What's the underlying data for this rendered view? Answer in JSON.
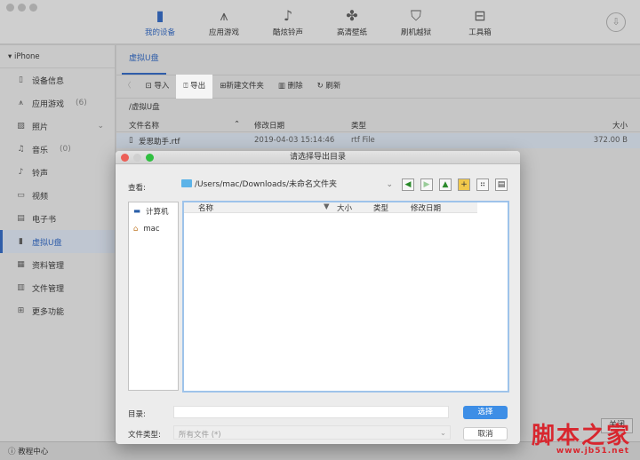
{
  "nav": [
    {
      "label": "我的设备",
      "icon": "phone-icon"
    },
    {
      "label": "应用游戏",
      "icon": "app-icon"
    },
    {
      "label": "酷炫铃声",
      "icon": "music-note-icon"
    },
    {
      "label": "高清壁纸",
      "icon": "clover-icon"
    },
    {
      "label": "刷机越狱",
      "icon": "shield-icon"
    },
    {
      "label": "工具箱",
      "icon": "toolbox-icon"
    }
  ],
  "sidebar": {
    "device": "iPhone",
    "items": [
      {
        "label": "设备信息"
      },
      {
        "label": "应用游戏",
        "count": "(6)"
      },
      {
        "label": "照片"
      },
      {
        "label": "音乐",
        "count": "(0)"
      },
      {
        "label": "铃声"
      },
      {
        "label": "视频"
      },
      {
        "label": "电子书"
      },
      {
        "label": "虚拟U盘"
      },
      {
        "label": "资料管理"
      },
      {
        "label": "文件管理"
      },
      {
        "label": "更多功能"
      }
    ],
    "help": "教程中心"
  },
  "main": {
    "tab": "虚拟U盘",
    "toolbar": {
      "import": "导入",
      "export": "导出",
      "new_folder": "新建文件夹",
      "delete": "删除",
      "refresh": "刷新"
    },
    "path": "/虚拟U盘",
    "columns": {
      "name": "文件名称",
      "date": "修改日期",
      "type": "类型",
      "size": "大小"
    },
    "rows": [
      {
        "name": "爱思助手.rtf",
        "date": "2019-04-03 15:14:46",
        "type": "rtf File",
        "size": "372.00 B"
      }
    ],
    "close_button": "关闭"
  },
  "dialog": {
    "title": "请选择导出目录",
    "look_in_label": "查看:",
    "look_in_value": "/Users/mac/Downloads/未命名文件夹",
    "places": [
      "计算机",
      "mac"
    ],
    "columns": {
      "name": "名称",
      "size": "大小",
      "type": "类型",
      "date": "修改日期"
    },
    "dir_label": "目录:",
    "dir_value": "",
    "filetype_label": "文件类型:",
    "filetype_value": "所有文件 (*)",
    "choose": "选择",
    "cancel": "取消"
  },
  "watermark": {
    "title": "脚本之家",
    "url": "www.jb51.net"
  },
  "colors": {
    "accent": "#2f5da9",
    "dialog_button": "#3d8ee6"
  }
}
